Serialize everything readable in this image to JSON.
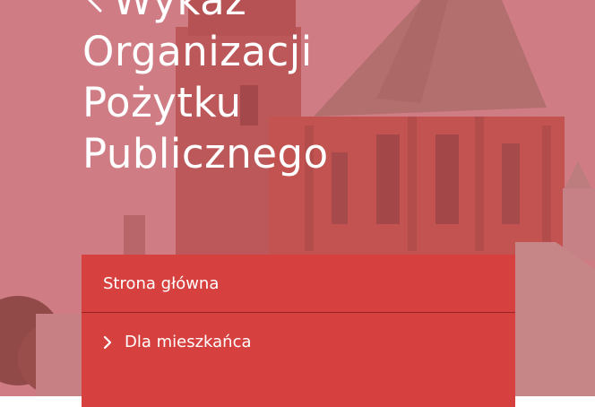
{
  "page": {
    "title_lines": [
      "Wykaz",
      "Organizacji",
      "Pożytku",
      "Publicznego"
    ],
    "back_icon": "chevron-left-icon"
  },
  "menu": {
    "items": [
      {
        "label": "Strona główna",
        "icon": null
      },
      {
        "label": "Dla mieszkańca",
        "icon": "chevron-right-icon"
      }
    ]
  },
  "colors": {
    "menu_background": "#d6403e",
    "hero_tint": "#c44a58",
    "text": "#ffffff"
  }
}
